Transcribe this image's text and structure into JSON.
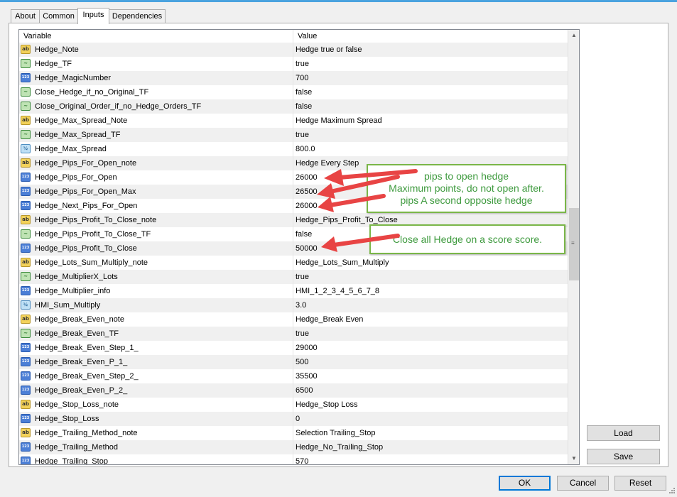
{
  "tabs": [
    {
      "label": "About"
    },
    {
      "label": "Common"
    },
    {
      "label": "Inputs"
    },
    {
      "label": "Dependencies"
    }
  ],
  "active_tab": "Inputs",
  "table": {
    "headers": {
      "variable": "Variable",
      "value": "Value"
    },
    "rows": [
      {
        "icon": "ab",
        "name": "Hedge_Note",
        "value": "Hedge true or false"
      },
      {
        "icon": "tf",
        "name": "Hedge_TF",
        "value": "true"
      },
      {
        "icon": "123",
        "name": "Hedge_MagicNumber",
        "value": "700"
      },
      {
        "icon": "tf",
        "name": "Close_Hedge_if_no_Original_TF",
        "value": "false"
      },
      {
        "icon": "tf",
        "name": "Close_Original_Order_if_no_Hedge_Orders_TF",
        "value": "false"
      },
      {
        "icon": "ab",
        "name": "Hedge_Max_Spread_Note",
        "value": "Hedge Maximum Spread"
      },
      {
        "icon": "tf",
        "name": "Hedge_Max_Spread_TF",
        "value": "true"
      },
      {
        "icon": "dbl",
        "name": "Hedge_Max_Spread",
        "value": "800.0"
      },
      {
        "icon": "ab",
        "name": "Hedge_Pips_For_Open_note",
        "value": "Hedge Every Step"
      },
      {
        "icon": "123",
        "name": "Hedge_Pips_For_Open",
        "value": "26000"
      },
      {
        "icon": "123",
        "name": "Hedge_Pips_For_Open_Max",
        "value": "26500"
      },
      {
        "icon": "123",
        "name": "Hedge_Next_Pips_For_Open",
        "value": "26000"
      },
      {
        "icon": "ab",
        "name": "Hedge_Pips_Profit_To_Close_note",
        "value": "Hedge_Pips_Profit_To_Close"
      },
      {
        "icon": "tf",
        "name": "Hedge_Pips_Profit_To_Close_TF",
        "value": "false"
      },
      {
        "icon": "123",
        "name": "Hedge_Pips_Profit_To_Close",
        "value": "50000"
      },
      {
        "icon": "ab",
        "name": "Hedge_Lots_Sum_Multiply_note",
        "value": "Hedge_Lots_Sum_Multiply"
      },
      {
        "icon": "tf",
        "name": "Hedge_MultiplierX_Lots",
        "value": "true"
      },
      {
        "icon": "123",
        "name": "Hedge_Multiplier_info",
        "value": "HMI_1_2_3_4_5_6_7_8"
      },
      {
        "icon": "dbl",
        "name": "HMI_Sum_Multiply",
        "value": "3.0"
      },
      {
        "icon": "ab",
        "name": "Hedge_Break_Even_note",
        "value": "Hedge_Break Even"
      },
      {
        "icon": "tf",
        "name": "Hedge_Break_Even_TF",
        "value": "true"
      },
      {
        "icon": "123",
        "name": "Hedge_Break_Even_Step_1_",
        "value": "29000"
      },
      {
        "icon": "123",
        "name": "Hedge_Break_Even_P_1_",
        "value": "500"
      },
      {
        "icon": "123",
        "name": "Hedge_Break_Even_Step_2_",
        "value": "35500"
      },
      {
        "icon": "123",
        "name": "Hedge_Break_Even_P_2_",
        "value": "6500"
      },
      {
        "icon": "ab",
        "name": "Hedge_Stop_Loss_note",
        "value": "Hedge_Stop Loss"
      },
      {
        "icon": "123",
        "name": "Hedge_Stop_Loss",
        "value": "0"
      },
      {
        "icon": "ab",
        "name": "Hedge_Trailing_Method_note",
        "value": "Selection Trailing_Stop"
      },
      {
        "icon": "123",
        "name": "Hedge_Trailing_Method",
        "value": "Hedge_No_Trailing_Stop"
      },
      {
        "icon": "123",
        "name": "Hedge_Trailing_Stop",
        "value": "570"
      }
    ]
  },
  "icon_glyphs": {
    "ab": "ab",
    "123": "123",
    "tf": "~",
    "dbl": "½"
  },
  "annotations": {
    "callout1": [
      "pips to open hedge",
      "Maximum points, do not open after.",
      "pips A second opposite hedge"
    ],
    "callout2": [
      "Close  all Hedge on a score score."
    ]
  },
  "side_buttons": {
    "load": "Load",
    "save": "Save"
  },
  "footer_buttons": {
    "ok": "OK",
    "cancel": "Cancel",
    "reset": "Reset"
  },
  "colors": {
    "annotation_border": "#7ab648",
    "annotation_text": "#3e9a3e",
    "arrow": "#e84444",
    "accent": "#4aa3df"
  }
}
